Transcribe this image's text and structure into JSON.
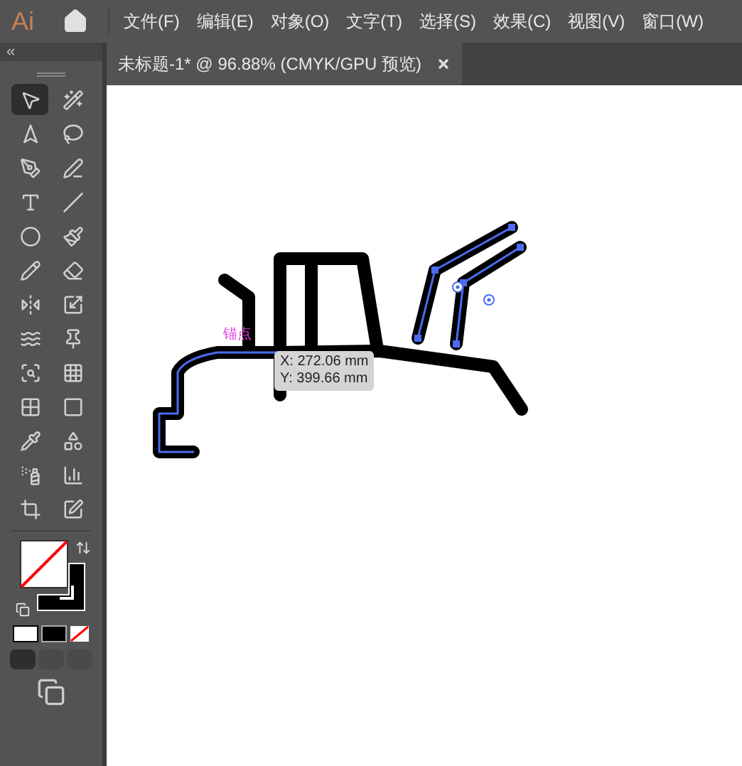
{
  "menu_bar": {
    "items": [
      "文件(F)",
      "编辑(E)",
      "对象(O)",
      "文字(T)",
      "选择(S)",
      "效果(C)",
      "视图(V)",
      "窗口(W)"
    ]
  },
  "app_logo": "Ai",
  "document_tab": {
    "title": "未标题-1* @ 96.88% (CMYK/GPU 预览)",
    "selected": true
  },
  "toolbox": {
    "tools": [
      {
        "selected": true
      },
      {
        "selected": false
      },
      {
        "selected": false
      },
      {
        "selected": false
      },
      {
        "selected": false
      },
      {
        "selected": false
      },
      {
        "selected": false
      },
      {
        "selected": false
      },
      {
        "selected": false
      },
      {
        "selected": false
      },
      {
        "selected": false
      },
      {
        "selected": false
      },
      {
        "selected": false
      },
      {
        "selected": false
      },
      {
        "selected": false
      },
      {
        "selected": false
      },
      {
        "selected": false
      },
      {
        "selected": false
      },
      {
        "selected": false
      },
      {
        "selected": false
      },
      {
        "selected": false
      },
      {
        "selected": false
      },
      {
        "selected": false
      },
      {
        "selected": false
      },
      {
        "selected": false
      },
      {
        "selected": false
      }
    ]
  },
  "canvas": {
    "anchor_label": "锚点",
    "tooltip": [
      "X: 272.06 mm",
      "Y: 399.66 mm"
    ]
  }
}
